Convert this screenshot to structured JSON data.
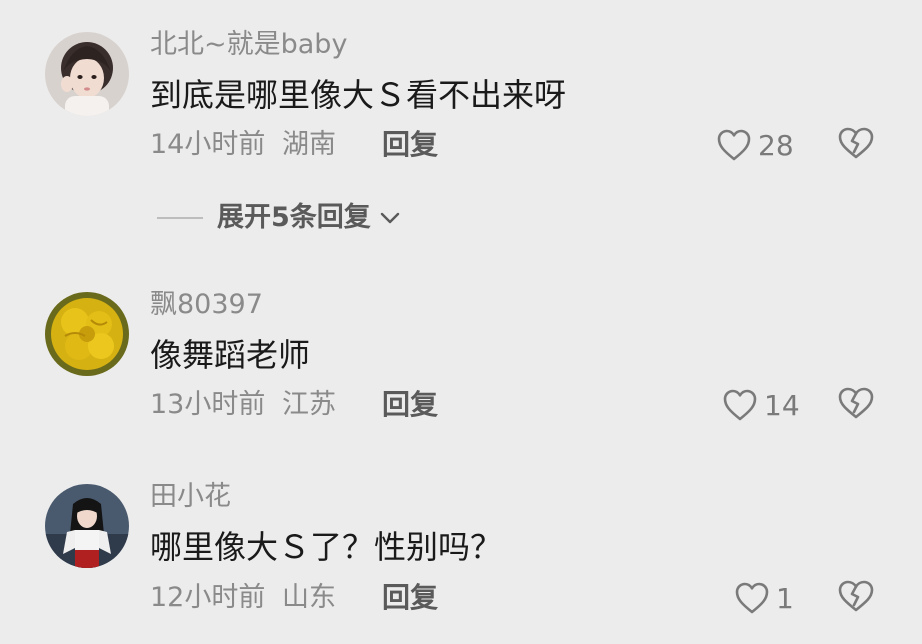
{
  "comments": [
    {
      "username": "北北~就是baby",
      "text": "到底是哪里像大Ｓ看不出来呀",
      "time": "14小时前",
      "location": "湖南",
      "reply_label": "回复",
      "likes": "28"
    },
    {
      "username": "飘80397",
      "text": "像舞蹈老师",
      "time": "13小时前",
      "location": "江苏",
      "reply_label": "回复",
      "likes": "14"
    },
    {
      "username": "田小花",
      "text": "哪里像大Ｓ了？性别吗？",
      "time": "12小时前",
      "location": "山东",
      "reply_label": "回复",
      "likes": "1"
    }
  ],
  "expand_replies": {
    "label": "展开5条回复"
  },
  "colors": {
    "background": "#ececec",
    "primary_text": "#1a1a1a",
    "secondary_text": "#8a8a8a",
    "icon": "#7a7a7a"
  },
  "icons": {
    "like": "heart-outline-icon",
    "dislike": "broken-heart-icon",
    "expand": "chevron-down-icon"
  }
}
